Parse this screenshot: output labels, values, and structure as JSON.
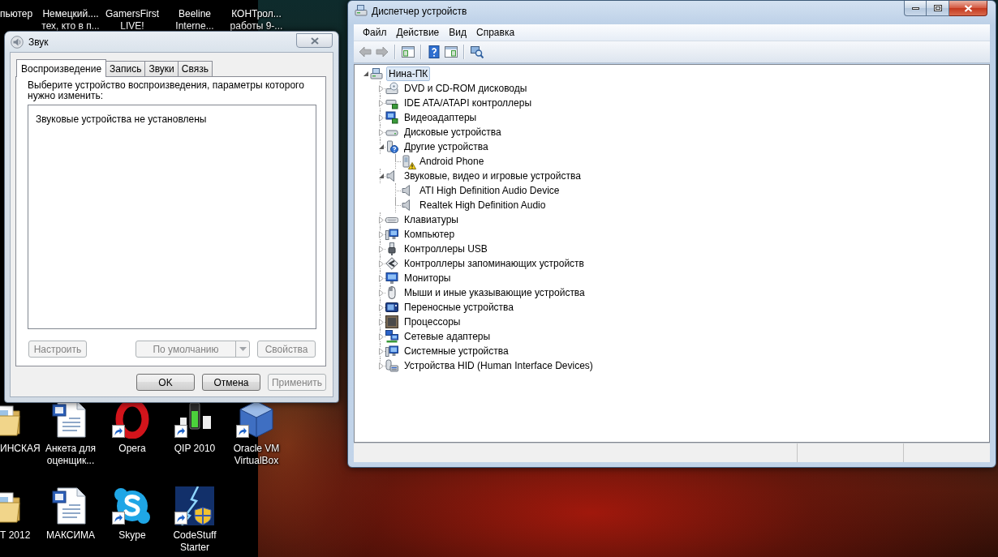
{
  "desktop": {
    "top_row": [
      {
        "lines": [
          "пьютер"
        ]
      },
      {
        "lines": [
          "Немецкий....",
          "тех, кто в п..."
        ]
      },
      {
        "lines": [
          "GamersFirst",
          "LIVE!"
        ]
      },
      {
        "lines": [
          "Beeline",
          "Interne..."
        ]
      },
      {
        "lines": [
          "КОНТрол...",
          "работы 9-..."
        ]
      }
    ],
    "rows": [
      [
        {
          "lines": [
            "ИНСКАЯ"
          ],
          "kind": "folder",
          "shortcut": false
        },
        {
          "lines": [
            "Анкета для",
            "оценщик..."
          ],
          "kind": "document",
          "shortcut": false
        },
        {
          "lines": [
            "Opera"
          ],
          "kind": "ring",
          "shortcut": true
        },
        {
          "lines": [
            "QIP 2010"
          ],
          "kind": "signal",
          "shortcut": true
        },
        {
          "lines": [
            "Oracle VM",
            "VirtualBox"
          ],
          "kind": "cube",
          "shortcut": true
        }
      ],
      [
        {
          "lines": [
            "Т 2012"
          ],
          "kind": "folder",
          "shortcut": false
        },
        {
          "lines": [
            "МАКСИМА"
          ],
          "kind": "document",
          "shortcut": false
        },
        {
          "lines": [
            "Skype"
          ],
          "kind": "bubble",
          "shortcut": true
        },
        {
          "lines": [
            "CodeStuff",
            "Starter"
          ],
          "kind": "lightning",
          "shortcut": true
        }
      ]
    ]
  },
  "sound_dialog": {
    "title": "Звук",
    "tabs": [
      {
        "label": "Воспроизведение",
        "selected": true
      },
      {
        "label": "Запись",
        "selected": false
      },
      {
        "label": "Звуки",
        "selected": false
      },
      {
        "label": "Связь",
        "selected": false
      }
    ],
    "instruction": "Выберите устройство воспроизведения, параметры которого нужно изменить:",
    "empty_message": "Звуковые устройства не установлены",
    "device_buttons": [
      {
        "label": "Настроить",
        "kind": "plain",
        "disabled": true
      },
      {
        "label": "По умолчанию",
        "kind": "split",
        "disabled": true
      },
      {
        "label": "Свойства",
        "kind": "plain",
        "disabled": true
      }
    ],
    "buttons": [
      {
        "label": "OK",
        "disabled": false
      },
      {
        "label": "Отмена",
        "disabled": false
      },
      {
        "label": "Применить",
        "disabled": true
      }
    ]
  },
  "device_manager": {
    "title": "Диспетчер устройств",
    "menu": [
      "Файл",
      "Действие",
      "Вид",
      "Справка"
    ],
    "toolbar": [
      [
        {
          "kind": "back",
          "disabled": true
        },
        {
          "kind": "forward",
          "disabled": true
        }
      ],
      [
        {
          "kind": "tree-pane",
          "disabled": false
        }
      ],
      [
        {
          "kind": "help",
          "disabled": false
        },
        {
          "kind": "action-pane",
          "disabled": false
        }
      ],
      [
        {
          "kind": "scan",
          "disabled": false
        }
      ]
    ],
    "tree": {
      "label": "Нина-ПК",
      "kind": "computer",
      "expanded": true,
      "selected": true,
      "children": [
        {
          "label": "DVD и CD-ROM дисководы",
          "kind": "dvd",
          "expanded": false,
          "selected": false
        },
        {
          "label": "IDE ATA/ATAPI контроллеры",
          "kind": "ide",
          "expanded": false,
          "selected": false
        },
        {
          "label": "Видеоадаптеры",
          "kind": "display",
          "expanded": false,
          "selected": false
        },
        {
          "label": "Дисковые устройства",
          "kind": "disk",
          "expanded": false,
          "selected": false
        },
        {
          "label": "Другие устройства",
          "kind": "other",
          "expanded": true,
          "selected": false,
          "children": [
            {
              "label": "Android Phone",
              "kind": "device",
              "problem": true,
              "selected": false
            }
          ]
        },
        {
          "label": "Звуковые, видео и игровые устройства",
          "kind": "sound",
          "expanded": true,
          "selected": false,
          "children": [
            {
              "label": "ATI High Definition Audio Device",
              "kind": "sound",
              "problem": false,
              "selected": false
            },
            {
              "label": "Realtek High Definition Audio",
              "kind": "sound",
              "problem": false,
              "selected": false
            }
          ]
        },
        {
          "label": "Клавиатуры",
          "kind": "keyboard",
          "expanded": false,
          "selected": false
        },
        {
          "label": "Компьютер",
          "kind": "workstation",
          "expanded": false,
          "selected": false
        },
        {
          "label": "Контроллеры USB",
          "kind": "usb",
          "expanded": false,
          "selected": false
        },
        {
          "label": "Контроллеры запоминающих устройств",
          "kind": "storage",
          "expanded": false,
          "selected": false
        },
        {
          "label": "Мониторы",
          "kind": "monitor",
          "expanded": false,
          "selected": false
        },
        {
          "label": "Мыши и иные указывающие устройства",
          "kind": "mouse",
          "expanded": false,
          "selected": false
        },
        {
          "label": "Переносные устройства",
          "kind": "portable",
          "expanded": false,
          "selected": false
        },
        {
          "label": "Процессоры",
          "kind": "cpu",
          "expanded": false,
          "selected": false
        },
        {
          "label": "Сетевые адаптеры",
          "kind": "network",
          "expanded": false,
          "selected": false
        },
        {
          "label": "Системные устройства",
          "kind": "system",
          "expanded": false,
          "selected": false
        },
        {
          "label": "Устройства HID (Human Interface Devices)",
          "kind": "hid",
          "expanded": false,
          "selected": false
        }
      ]
    }
  }
}
